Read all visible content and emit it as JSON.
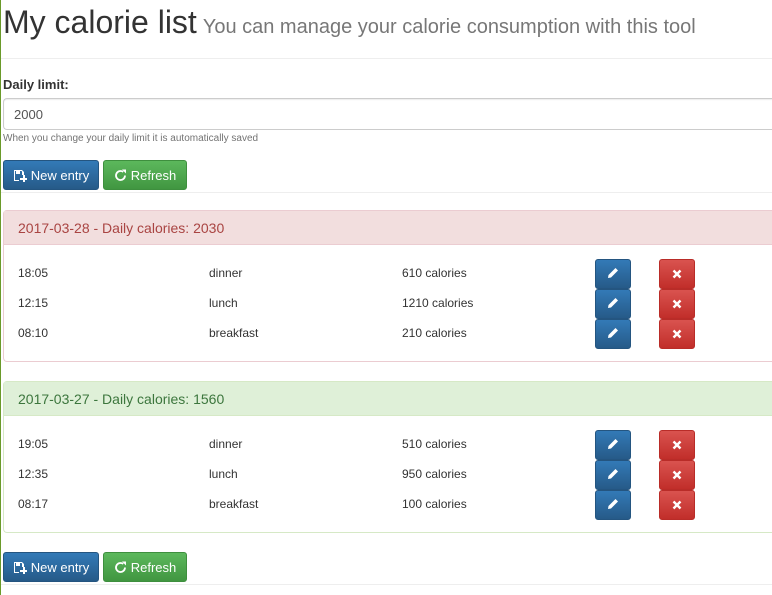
{
  "header": {
    "title": "My calorie list",
    "subtitle": "You can manage your calorie consumption with this tool"
  },
  "limit": {
    "label": "Daily limit:",
    "value": "2000",
    "help": "When you change your daily limit it is automatically saved"
  },
  "buttons": {
    "new_entry": "New entry",
    "refresh": "Refresh"
  },
  "days": [
    {
      "heading": "2017-03-28 - Daily calories: 2030",
      "status": "over-limit",
      "color": "#f2dede",
      "entries": [
        {
          "time": "18:05",
          "meal": "dinner",
          "calories": "610 calories"
        },
        {
          "time": "12:15",
          "meal": "lunch",
          "calories": "1210 calories"
        },
        {
          "time": "08:10",
          "meal": "breakfast",
          "calories": "210 calories"
        }
      ]
    },
    {
      "heading": "2017-03-27 - Daily calories: 1560",
      "status": "under-limit",
      "color": "#dff0d8",
      "entries": [
        {
          "time": "19:05",
          "meal": "dinner",
          "calories": "510 calories"
        },
        {
          "time": "12:35",
          "meal": "lunch",
          "calories": "950 calories"
        },
        {
          "time": "08:17",
          "meal": "breakfast",
          "calories": "100 calories"
        }
      ]
    }
  ],
  "icons": {
    "new_entry": "new-entry-icon",
    "refresh": "refresh-icon",
    "edit": "pencil-icon",
    "delete": "close-icon"
  }
}
